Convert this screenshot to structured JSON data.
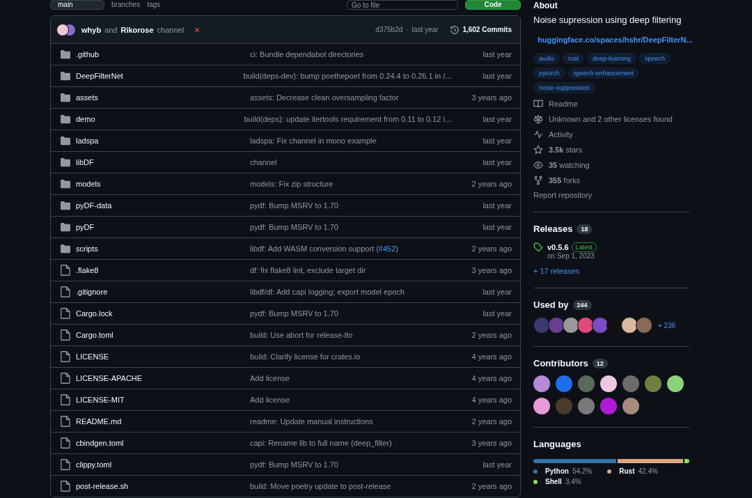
{
  "top_bar": {
    "branch": "main",
    "branches": "branches",
    "tags": "tags",
    "search": {
      "placeholder": "Go to file"
    },
    "code_button": "Code"
  },
  "commit_bar": {
    "avatars": [
      {
        "color": "#f3c6d6"
      },
      {
        "color": "#8a6bd1"
      }
    ],
    "author_1": "whyb",
    "conjunction": "and",
    "author_2": "Rikorose",
    "message": "channel",
    "status": "×",
    "sha": "d375b2d",
    "separator": "·",
    "time": "last year",
    "commits": "1,602 Commits"
  },
  "files": [
    {
      "kind": "folder",
      "name": ".github",
      "message": [
        {
          "text": "ci: Bundle dependabot directories"
        }
      ],
      "time": "last year"
    },
    {
      "kind": "folder",
      "name": "DeepFilterNet",
      "message": [
        {
          "text": "build(deps-dev): bump poethepoet from 0.24.4 to 0.26.1 in /..."
        }
      ],
      "time": "last year"
    },
    {
      "kind": "folder",
      "name": "assets",
      "message": [
        {
          "text": "assets: Decrease clean oversampling factor"
        }
      ],
      "time": "3 years ago"
    },
    {
      "kind": "folder",
      "name": "demo",
      "message": [
        {
          "text": "build(deps): update itertools requirement from 0.11 to 0.12 i..."
        }
      ],
      "time": "last year"
    },
    {
      "kind": "folder",
      "name": "ladspa",
      "message": [
        {
          "text": "ladspa: Fix channel in mono example"
        }
      ],
      "time": "last year"
    },
    {
      "kind": "folder",
      "name": "libDF",
      "message": [
        {
          "text": "channel"
        }
      ],
      "time": "last year"
    },
    {
      "kind": "folder",
      "name": "models",
      "message": [
        {
          "text": "models: Fix zip structure"
        }
      ],
      "time": "2 years ago"
    },
    {
      "kind": "folder",
      "name": "pyDF-data",
      "message": [
        {
          "text": "pydf: Bump MSRV to 1.70"
        }
      ],
      "time": "last year"
    },
    {
      "kind": "folder",
      "name": "pyDF",
      "message": [
        {
          "text": "pydf: Bump MSRV to 1.70"
        }
      ],
      "time": "last year"
    },
    {
      "kind": "folder",
      "name": "scripts",
      "message": [
        {
          "text": "libdf: Add WASM conversion support ("
        },
        {
          "link": "#452"
        },
        {
          "text": ")"
        }
      ],
      "time": "2 years ago"
    },
    {
      "kind": "file",
      "name": ".flake8",
      "message": [
        {
          "text": "df: fix flake8 lint, exclude target dir"
        }
      ],
      "time": "3 years ago"
    },
    {
      "kind": "file",
      "name": ".gitignore",
      "message": [
        {
          "text": "libdf/df: Add capi logging; export model epoch"
        }
      ],
      "time": "last year"
    },
    {
      "kind": "file",
      "name": "Cargo.lock",
      "message": [
        {
          "text": "pydf: Bump MSRV to 1.70"
        }
      ],
      "time": "last year"
    },
    {
      "kind": "file",
      "name": "Cargo.toml",
      "message": [
        {
          "text": "build: Use abort for release-lto"
        }
      ],
      "time": "2 years ago"
    },
    {
      "kind": "file",
      "name": "LICENSE",
      "message": [
        {
          "text": "build: Clarify license for crates.io"
        }
      ],
      "time": "4 years ago"
    },
    {
      "kind": "file",
      "name": "LICENSE-APACHE",
      "message": [
        {
          "text": "Add license"
        }
      ],
      "time": "4 years ago"
    },
    {
      "kind": "file",
      "name": "LICENSE-MIT",
      "message": [
        {
          "text": "Add license"
        }
      ],
      "time": "4 years ago"
    },
    {
      "kind": "file",
      "name": "README.md",
      "message": [
        {
          "text": "readme: Update manual instructions"
        }
      ],
      "time": "2 years ago"
    },
    {
      "kind": "file",
      "name": "cbindgen.toml",
      "message": [
        {
          "text": "capi: Rename lib to full name (deep_filter)"
        }
      ],
      "time": "3 years ago"
    },
    {
      "kind": "file",
      "name": "clippy.toml",
      "message": [
        {
          "text": "pydf: Bump MSRV to 1.70"
        }
      ],
      "time": "last year"
    },
    {
      "kind": "file",
      "name": "post-release.sh",
      "message": [
        {
          "text": "build: Move poetry update to post-release"
        }
      ],
      "time": "2 years ago"
    }
  ],
  "about": {
    "title": "About",
    "description": "Noise supression using deep filtering",
    "link": "huggingface.co/spaces/hshr/DeepFilterN...",
    "topics": [
      "audio",
      "rust",
      "deep-learning",
      "speech",
      "pytorch",
      "speech-enhancement",
      "noise-suppression"
    ],
    "stats": [
      {
        "kind": "book",
        "text": "Readme"
      },
      {
        "kind": "scale",
        "text": "Unknown and 2 other licenses found"
      },
      {
        "kind": "pulse",
        "text": "Activity"
      },
      {
        "kind": "star",
        "strong": "3.5k",
        "text": "stars"
      },
      {
        "kind": "eye",
        "strong": "35",
        "text": "watching"
      },
      {
        "kind": "fork",
        "strong": "355",
        "text": "forks"
      }
    ],
    "report": "Report repository"
  },
  "releases": {
    "title": "Releases",
    "count": "18",
    "tag": "v0.5.6",
    "badge": "Latest",
    "date": "on Sep 1, 2023",
    "more": "+ 17 releases"
  },
  "used_by": {
    "title": "Used by",
    "count": "244",
    "avatars": [
      {
        "color": "#3b3a6e"
      },
      {
        "color": "#6a3f8f"
      },
      {
        "color": "#9a9a9a"
      },
      {
        "color": "#e04a7a"
      },
      {
        "color": "#7a4bc2"
      },
      {
        "color": "#111111"
      },
      {
        "color": "#d9b8a0"
      },
      {
        "color": "#8a6a55"
      }
    ],
    "more": "+ 236"
  },
  "contributors": {
    "title": "Contributors",
    "count": "12",
    "avatars": [
      {
        "color": "#b58ad9"
      },
      {
        "color": "#1f6feb"
      },
      {
        "color": "#5a6a5a"
      },
      {
        "color": "#f0c6de"
      },
      {
        "color": "#6b6b6b"
      },
      {
        "color": "#6f7f3f"
      },
      {
        "color": "#8bd37a"
      },
      {
        "color": "#e69ad8"
      },
      {
        "color": "#4a3a2a"
      },
      {
        "color": "#7a7a7a"
      },
      {
        "color": "#b01ad8"
      },
      {
        "color": "#a88a80"
      }
    ]
  },
  "languages": {
    "title": "Languages",
    "items": [
      {
        "name": "Python",
        "percent": "54.2%",
        "color": "#3572a5"
      },
      {
        "name": "Rust",
        "percent": "42.4%",
        "color": "#dea584"
      },
      {
        "name": "Shell",
        "percent": "3.4%",
        "color": "#89e051"
      }
    ]
  }
}
